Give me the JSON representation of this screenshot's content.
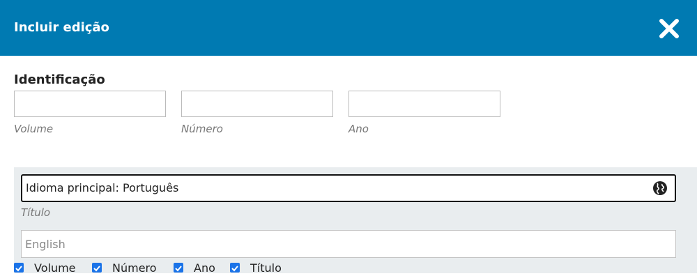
{
  "modal": {
    "title": "Incluir edição",
    "close_icon": "close-icon"
  },
  "identification": {
    "heading": "Identificação",
    "fields": [
      {
        "label": "Volume",
        "value": ""
      },
      {
        "label": "Número",
        "value": ""
      },
      {
        "label": "Ano",
        "value": ""
      }
    ]
  },
  "title_section": {
    "primary_value": "Idioma principal: Português",
    "language_icon": "globe-icon",
    "label": "Título",
    "english_placeholder": "English"
  },
  "show_options": [
    {
      "label": "Volume",
      "checked": true
    },
    {
      "label": "Número",
      "checked": true
    },
    {
      "label": "Ano",
      "checked": true
    },
    {
      "label": "Título",
      "checked": true
    }
  ],
  "colors": {
    "header": "#007ab2",
    "panel": "#e9edef",
    "checkbox": "#1a73e8"
  }
}
